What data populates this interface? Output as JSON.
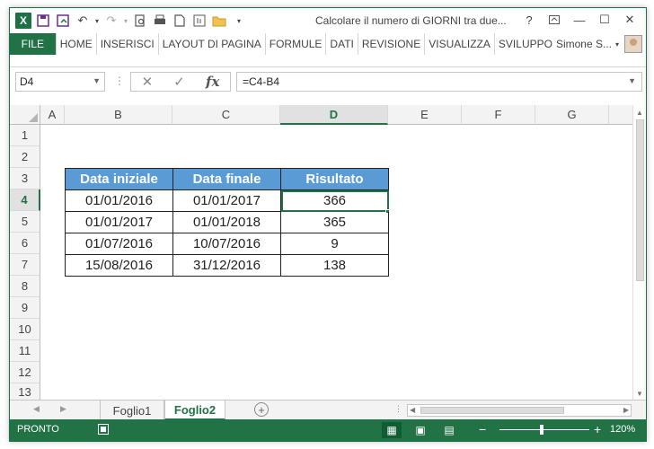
{
  "window": {
    "title": "Calcolare il numero di GIORNI tra due...",
    "help": "?"
  },
  "ribbon": {
    "file": "FILE",
    "tabs": [
      "HOME",
      "INSERISCI",
      "LAYOUT DI PAGINA",
      "FORMULE",
      "DATI",
      "REVISIONE",
      "VISUALIZZA",
      "SVILUPPO"
    ],
    "user": "Simone S..."
  },
  "formula_bar": {
    "name_box": "D4",
    "formula": "=C4-B4",
    "fx": "fx"
  },
  "grid": {
    "columns": [
      "A",
      "B",
      "C",
      "D",
      "E",
      "F",
      "G"
    ],
    "selected_column": "D",
    "rows": [
      "1",
      "2",
      "3",
      "4",
      "5",
      "6",
      "7",
      "8",
      "9",
      "10",
      "11",
      "12",
      "13"
    ],
    "selected_row": "4"
  },
  "table": {
    "headers": [
      "Data iniziale",
      "Data finale",
      "Risultato"
    ],
    "rows": [
      [
        "01/01/2016",
        "01/01/2017",
        "366"
      ],
      [
        "01/01/2017",
        "01/01/2018",
        "365"
      ],
      [
        "01/07/2016",
        "10/07/2016",
        "9"
      ],
      [
        "15/08/2016",
        "31/12/2016",
        "138"
      ]
    ],
    "header_color": "#5B9BD5"
  },
  "sheets": {
    "tabs": [
      "Foglio1",
      "Foglio2"
    ],
    "active": "Foglio2"
  },
  "status": {
    "text": "PRONTO",
    "zoom": "120%"
  },
  "colors": {
    "accent": "#217346"
  }
}
